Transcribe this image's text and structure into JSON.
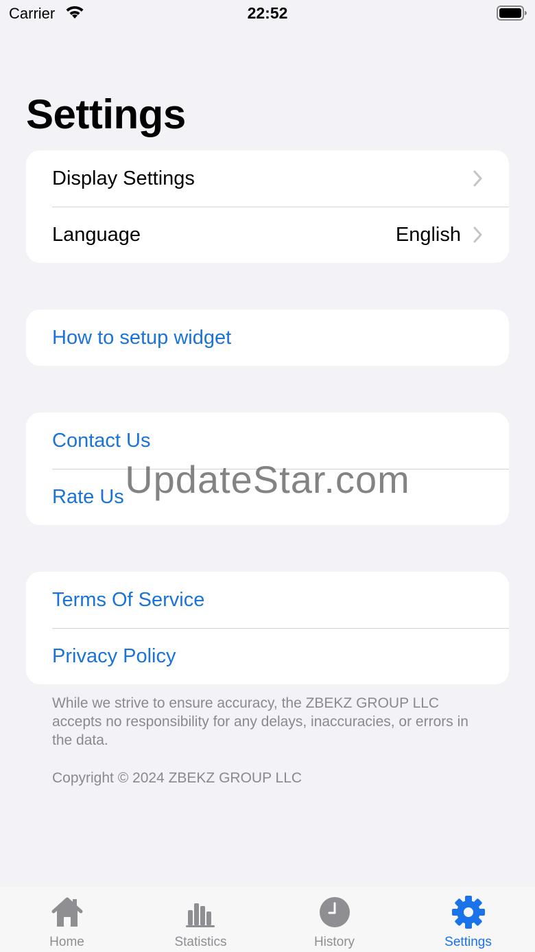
{
  "status_bar": {
    "carrier": "Carrier",
    "time": "22:52",
    "wifi_icon": "wifi-icon",
    "battery_icon": "battery-icon"
  },
  "page": {
    "title": "Settings"
  },
  "groups": {
    "general": {
      "display_settings_label": "Display Settings",
      "language_label": "Language",
      "language_value": "English"
    },
    "widget": {
      "how_to_setup_label": "How to setup widget"
    },
    "feedback": {
      "contact_label": "Contact Us",
      "rate_label": "Rate Us"
    },
    "legal": {
      "terms_label": "Terms Of Service",
      "privacy_label": "Privacy Policy"
    }
  },
  "footer": {
    "disclaimer": "While we strive to ensure accuracy, the ZBEKZ GROUP LLC accepts no responsibility for any delays, inaccuracies, or errors in the data.",
    "copyright": "Copyright © 2024 ZBEKZ GROUP LLC"
  },
  "watermark": "UpdateStar.com",
  "tab_bar": {
    "tabs": [
      {
        "label": "Home",
        "icon": "home-icon",
        "active": false
      },
      {
        "label": "Statistics",
        "icon": "statistics-icon",
        "active": false
      },
      {
        "label": "History",
        "icon": "history-icon",
        "active": false
      },
      {
        "label": "Settings",
        "icon": "gear-icon",
        "active": true
      }
    ]
  },
  "colors": {
    "background": "#f2f2f7",
    "link": "#1a73d9",
    "accent": "#1a73e8",
    "inactive_tab": "#8e8e93"
  }
}
